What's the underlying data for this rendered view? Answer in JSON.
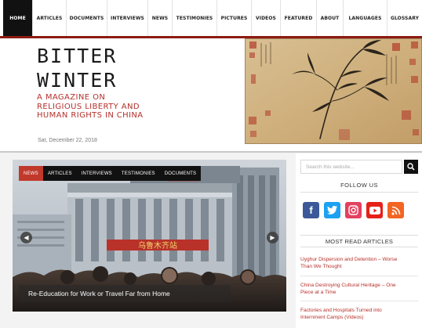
{
  "nav": {
    "items": [
      "HOME",
      "ARTICLES",
      "DOCUMENTS",
      "INTERVIEWS",
      "NEWS",
      "TESTIMONIES",
      "PICTURES",
      "VIDEOS",
      "FEATURED",
      "ABOUT",
      "LANGUAGES",
      "GLOSSARY"
    ],
    "active": "HOME"
  },
  "header": {
    "logo_line1": "BITTER",
    "logo_line2": "WINTER",
    "tagline_line1": "A MAGAZINE ON",
    "tagline_line2": "RELIGIOUS LIBERTY AND",
    "tagline_line3": "HUMAN RIGHTS IN CHINA",
    "date": "Sat, December 22, 2018"
  },
  "slider": {
    "tabs": [
      "NEWS",
      "ARTICLES",
      "INTERVIEWS",
      "TESTIMONIES",
      "DOCUMENTS"
    ],
    "active_tab": "NEWS",
    "caption": "Re-Education for Work or Travel Far from Home",
    "sign_text": "乌鲁木齐站"
  },
  "sidebar": {
    "search_placeholder": "Search this website...",
    "follow_heading": "FOLLOW US",
    "social": [
      {
        "icon": "facebook-icon",
        "glyph": "f",
        "color": "#3b5998"
      },
      {
        "icon": "twitter-icon",
        "glyph": "t",
        "color": "#1da1f2"
      },
      {
        "icon": "instagram-icon",
        "glyph": "◎",
        "color": "#e4405f"
      },
      {
        "icon": "youtube-icon",
        "glyph": "▶",
        "color": "#e62117"
      },
      {
        "icon": "rss-icon",
        "glyph": "◣",
        "color": "#f26522"
      }
    ],
    "most_read_heading": "MOST READ ARTICLES",
    "articles": [
      {
        "line1": "Uyghur Dispersion and Detention – Worse",
        "line2": "Than We Thought"
      },
      {
        "line1": "China Destroying Cultural Heritage – One",
        "line2": "Piece at a Time"
      },
      {
        "line1": "Factories and Hospitals Turned into",
        "line2": "Internment Camps (Videos)"
      }
    ]
  },
  "colors": {
    "accent_red": "#b5302a",
    "nav_border": "#8c1c13",
    "active_tab": "#c0392b"
  }
}
